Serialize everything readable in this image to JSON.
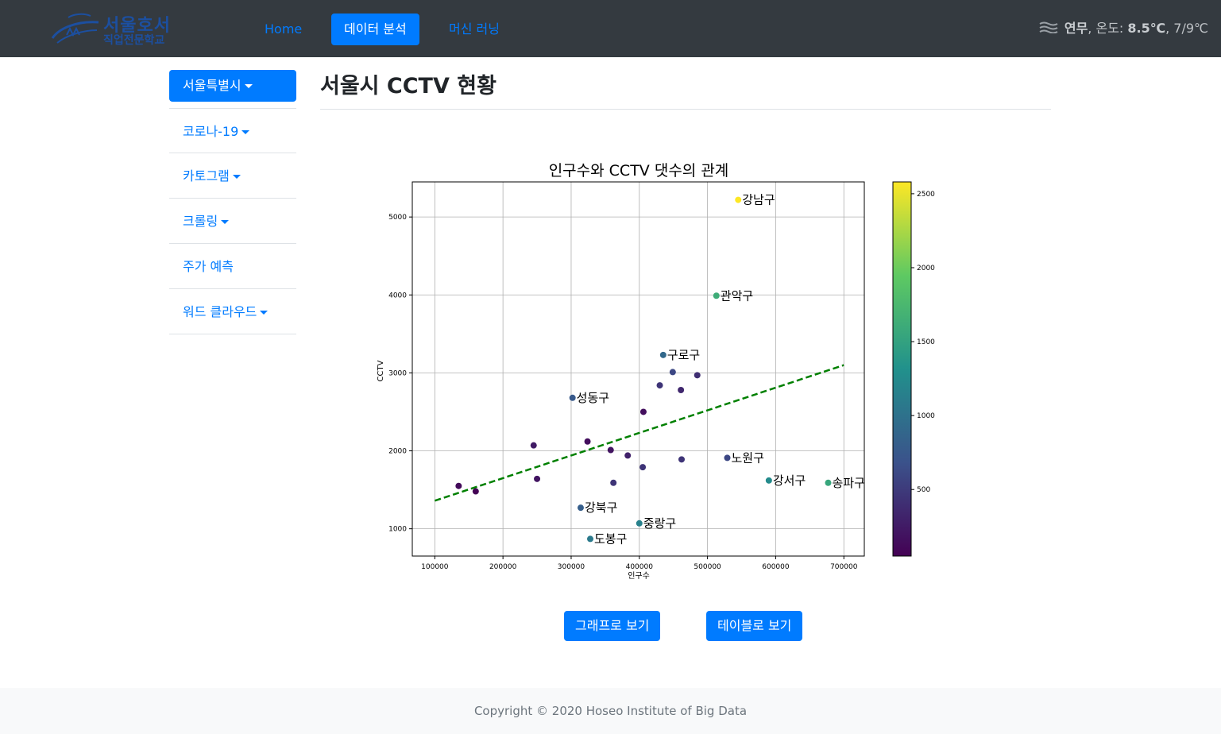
{
  "navbar": {
    "brand_line1": "서울호서",
    "brand_line2": "직업전문학교",
    "links": [
      {
        "label": "Home"
      },
      {
        "label": "데이터 분석"
      },
      {
        "label": "머신 러닝"
      }
    ],
    "weather": {
      "icon": "fog-icon",
      "condition": "연무",
      "temp_label": ", 온도: ",
      "temp_current": "8.5℃",
      "temp_range": ", 7/9℃"
    }
  },
  "sidebar": {
    "items": [
      {
        "label": "서울특별시"
      },
      {
        "label": "코로나-19"
      },
      {
        "label": "카토그램"
      },
      {
        "label": "크롤링"
      },
      {
        "label": "주가 예측"
      },
      {
        "label": "워드 클라우드"
      }
    ]
  },
  "main": {
    "title": "서울시 CCTV 현황",
    "buttons": {
      "graph": "그래프로 보기",
      "table": "테이블로 보기"
    }
  },
  "footer": {
    "copyright": "Copyright © 2020 Hoseo Institute of Big Data"
  },
  "colors": {
    "navbar_bg": "#343a40",
    "accent": "#007bff",
    "trend": "#008000"
  },
  "chart_data": {
    "type": "scatter",
    "title": "인구수와 CCTV 댓수의 관계",
    "xlabel": "인구수",
    "ylabel": "CCTV",
    "xlim": [
      67000,
      730000
    ],
    "ylim": [
      650,
      5450
    ],
    "xticks": [
      100000,
      200000,
      300000,
      400000,
      500000,
      600000,
      700000
    ],
    "yticks": [
      1000,
      2000,
      3000,
      4000,
      5000
    ],
    "grid": true,
    "colorbar": {
      "colormap": "viridis",
      "min": 50,
      "max": 2580,
      "ticks": [
        500,
        1000,
        1500,
        2000,
        2500
      ]
    },
    "trendline": {
      "style": "dashed",
      "points": [
        [
          100000,
          1360
        ],
        [
          700000,
          3100
        ]
      ]
    },
    "points": [
      {
        "x": 545000,
        "y": 5220,
        "c": 2580,
        "label": "강남구"
      },
      {
        "x": 513000,
        "y": 3990,
        "c": 1620,
        "label": "관악구"
      },
      {
        "x": 435000,
        "y": 3230,
        "c": 900,
        "label": "구로구"
      },
      {
        "x": 302000,
        "y": 2680,
        "c": 750,
        "label": "성동구"
      },
      {
        "x": 529000,
        "y": 1910,
        "c": 600,
        "label": "노원구"
      },
      {
        "x": 590000,
        "y": 1620,
        "c": 1250,
        "label": "강서구"
      },
      {
        "x": 677000,
        "y": 1590,
        "c": 1550,
        "label": "송파구"
      },
      {
        "x": 314000,
        "y": 1270,
        "c": 800,
        "label": "강북구"
      },
      {
        "x": 400000,
        "y": 1070,
        "c": 1150,
        "label": "중랑구"
      },
      {
        "x": 328000,
        "y": 870,
        "c": 1080,
        "label": "도봉구"
      },
      {
        "x": 449000,
        "y": 3010,
        "c": 600,
        "label": ""
      },
      {
        "x": 485000,
        "y": 2970,
        "c": 400,
        "label": ""
      },
      {
        "x": 430000,
        "y": 2840,
        "c": 450,
        "label": ""
      },
      {
        "x": 461000,
        "y": 2780,
        "c": 350,
        "label": ""
      },
      {
        "x": 406000,
        "y": 2500,
        "c": 150,
        "label": ""
      },
      {
        "x": 245000,
        "y": 2070,
        "c": 250,
        "label": ""
      },
      {
        "x": 324000,
        "y": 2120,
        "c": 150,
        "label": ""
      },
      {
        "x": 358000,
        "y": 2010,
        "c": 200,
        "label": ""
      },
      {
        "x": 383000,
        "y": 1940,
        "c": 300,
        "label": ""
      },
      {
        "x": 462000,
        "y": 1890,
        "c": 450,
        "label": ""
      },
      {
        "x": 405000,
        "y": 1790,
        "c": 450,
        "label": ""
      },
      {
        "x": 250000,
        "y": 1640,
        "c": 200,
        "label": ""
      },
      {
        "x": 362000,
        "y": 1590,
        "c": 450,
        "label": ""
      },
      {
        "x": 135000,
        "y": 1550,
        "c": 120,
        "label": ""
      },
      {
        "x": 160000,
        "y": 1480,
        "c": 60,
        "label": ""
      }
    ]
  }
}
